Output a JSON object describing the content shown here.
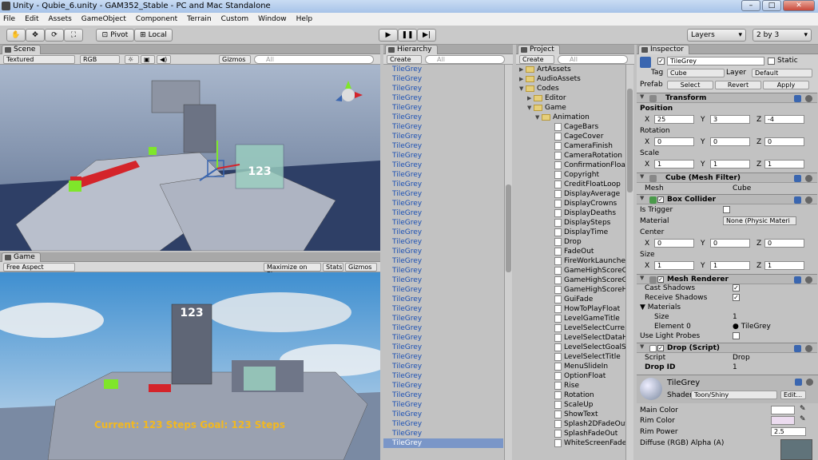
{
  "window": {
    "title": "Unity - Qubie_6.unity - GAM352_Stable - PC and Mac Standalone",
    "minimize": "–",
    "maximize": "□",
    "close": "✕"
  },
  "menu": [
    "File",
    "Edit",
    "Assets",
    "GameObject",
    "Component",
    "Terrain",
    "Custom",
    "Window",
    "Help"
  ],
  "toolbar": {
    "pivot": "Pivot",
    "local": "Local",
    "layers": "Layers",
    "layout": "2 by 3"
  },
  "scene": {
    "tab": "Scene",
    "render_mode": "Textured",
    "color_mode": "RGB",
    "gizmos": "Gizmos",
    "search": "All"
  },
  "game": {
    "tab": "Game",
    "aspect": "Free Aspect",
    "maximize": "Maximize on Play",
    "stats": "Stats",
    "gizmos": "Gizmos",
    "score": "123",
    "hud": "Current: 123 Steps  Goal: 123 Steps"
  },
  "hierarchy": {
    "tab": "Hierarchy",
    "create": "Create",
    "search": "All",
    "items": [
      "TileGrey",
      "TileGrey",
      "TileGrey",
      "TileGrey",
      "TileGrey",
      "TileGrey",
      "TileGrey",
      "TileGrey",
      "TileGrey",
      "TileGrey",
      "TileGrey",
      "TileGrey",
      "TileGrey",
      "TileGrey",
      "TileGrey",
      "TileGrey",
      "TileGrey",
      "TileGrey",
      "TileGrey",
      "TileGrey",
      "TileGrey",
      "TileGrey",
      "TileGrey",
      "TileGrey",
      "TileGrey",
      "TileGrey",
      "TileGrey",
      "TileGrey",
      "TileGrey",
      "TileGrey",
      "TileGrey",
      "TileGrey",
      "TileGrey",
      "TileGrey",
      "TileGrey",
      "TileGrey",
      "TileGrey",
      "TileGrey",
      "TileGrey",
      "TileGrey"
    ]
  },
  "project": {
    "tab": "Project",
    "create": "Create",
    "search": "All",
    "folders": [
      {
        "name": "ArtAssets",
        "depth": 0,
        "open": false
      },
      {
        "name": "AudioAssets",
        "depth": 0,
        "open": false
      },
      {
        "name": "Codes",
        "depth": 0,
        "open": true
      },
      {
        "name": "Editor",
        "depth": 1,
        "open": false
      },
      {
        "name": "Game",
        "depth": 1,
        "open": true
      },
      {
        "name": "Animation",
        "depth": 2,
        "open": true
      }
    ],
    "scripts": [
      "CageBars",
      "CageCover",
      "CameraFinish",
      "CameraRotation",
      "ConfirmationFloat",
      "Copyright",
      "CreditFloatLoop",
      "DisplayAverage",
      "DisplayCrowns",
      "DisplayDeaths",
      "DisplaySteps",
      "DisplayTime",
      "Drop",
      "FadeOut",
      "FireWorkLauncher",
      "GameHighScoreC",
      "GameHighScoreG",
      "GameHighScoreH",
      "GuiFade",
      "HowToPlayFloat",
      "LevelGameTitle",
      "LevelSelectCurrer",
      "LevelSelectDataH",
      "LevelSelectGoalSt",
      "LevelSelectTitle",
      "MenuSlideIn",
      "OptionFloat",
      "Rise",
      "Rotation",
      "ScaleUp",
      "ShowText",
      "Splash2DFadeOut",
      "SplashFadeOut",
      "WhiteScreenFadeI"
    ]
  },
  "inspector": {
    "tab": "Inspector",
    "name": "TileGrey",
    "static": "Static",
    "tag_label": "Tag",
    "tag": "Cube",
    "layer_label": "Layer",
    "layer": "Default",
    "prefab_label": "Prefab",
    "select": "Select",
    "revert": "Revert",
    "apply": "Apply",
    "transform": {
      "title": "Transform",
      "position": "Position",
      "rotation": "Rotation",
      "scale": "Scale",
      "pos": [
        "25",
        "3",
        "-4"
      ],
      "rot": [
        "0",
        "0",
        "0"
      ],
      "scl": [
        "1",
        "1",
        "1"
      ],
      "x": "X",
      "y": "Y",
      "z": "Z"
    },
    "mesh_filter": {
      "title": "Cube (Mesh Filter)",
      "mesh_label": "Mesh",
      "mesh": "Cube"
    },
    "box_collider": {
      "title": "Box Collider",
      "is_trigger": "Is Trigger",
      "material_label": "Material",
      "material": "None (Physic Materi",
      "center": "Center",
      "size": "Size",
      "c": [
        "0",
        "0",
        "0"
      ],
      "s": [
        "1",
        "1",
        "1"
      ]
    },
    "mesh_renderer": {
      "title": "Mesh Renderer",
      "cast": "Cast Shadows",
      "receive": "Receive Shadows",
      "materials": "Materials",
      "size_label": "Size",
      "size": "1",
      "element_label": "Element 0",
      "element": "TileGrey",
      "light_probes": "Use Light Probes"
    },
    "drop": {
      "title": "Drop (Script)",
      "script_label": "Script",
      "script": "Drop",
      "dropid_label": "Drop ID",
      "dropid": "1"
    },
    "material": {
      "name": "TileGrey",
      "shader_label": "Shader",
      "shader": "Toon/Shiny",
      "edit": "Edit...",
      "main_color": "Main Color",
      "rim_color": "Rim Color",
      "rim_power": "Rim Power",
      "rim_power_val": "2.5",
      "diffuse": "Diffuse (RGB) Alpha (A)"
    }
  },
  "colors": {
    "selection": "#1a4fb3",
    "blue": "#3a66b0",
    "red": "#d4242a",
    "green": "#7fe62a"
  }
}
